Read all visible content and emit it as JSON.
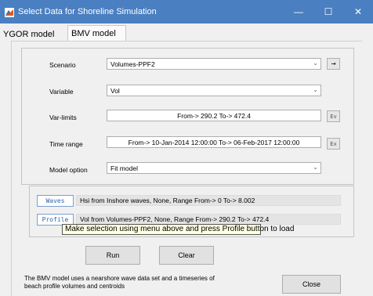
{
  "window": {
    "title": "Select Data for Shoreline Simulation",
    "minimize_glyph": "—",
    "maximize_glyph": "☐",
    "close_glyph": "✕",
    "titlebar_color": "#4a7fc1"
  },
  "tabs": [
    {
      "label": "YGOR model",
      "selected": false
    },
    {
      "label": "BMV model",
      "selected": true
    }
  ],
  "form": {
    "scenario": {
      "label": "Scenario",
      "value": "Volumes-PPF2",
      "side_button": "→"
    },
    "variable": {
      "label": "Variable",
      "value": "Vol"
    },
    "var_limits": {
      "label": "Var-limits",
      "value": "From-> 290.2  To-> 472.4",
      "button": "Ev"
    },
    "time_range": {
      "label": "Time range",
      "value": "From-> 10-Jan-2014 12:00:00  To-> 06-Feb-2017 12:00:00",
      "button": "Ex"
    },
    "model_option": {
      "label": "Model option",
      "value": "Fit model"
    }
  },
  "data_sources": {
    "waves": {
      "button": "Waves",
      "text": "Hsi from Inshore waves, None, Range From-> 0  To-> 8.002"
    },
    "profile": {
      "button": "Profile",
      "text": "Vol from Volumes-PPF2, None, Range From-> 290.2  To-> 472.4"
    },
    "tooltip": "Make selection using menu above and press Profile button to load"
  },
  "actions": {
    "run": "Run",
    "clear": "Clear",
    "close": "Close"
  },
  "footer": {
    "text": "The BMV model uses a nearshore wave data set and a timeseries of beach profile volumes and centroids"
  }
}
